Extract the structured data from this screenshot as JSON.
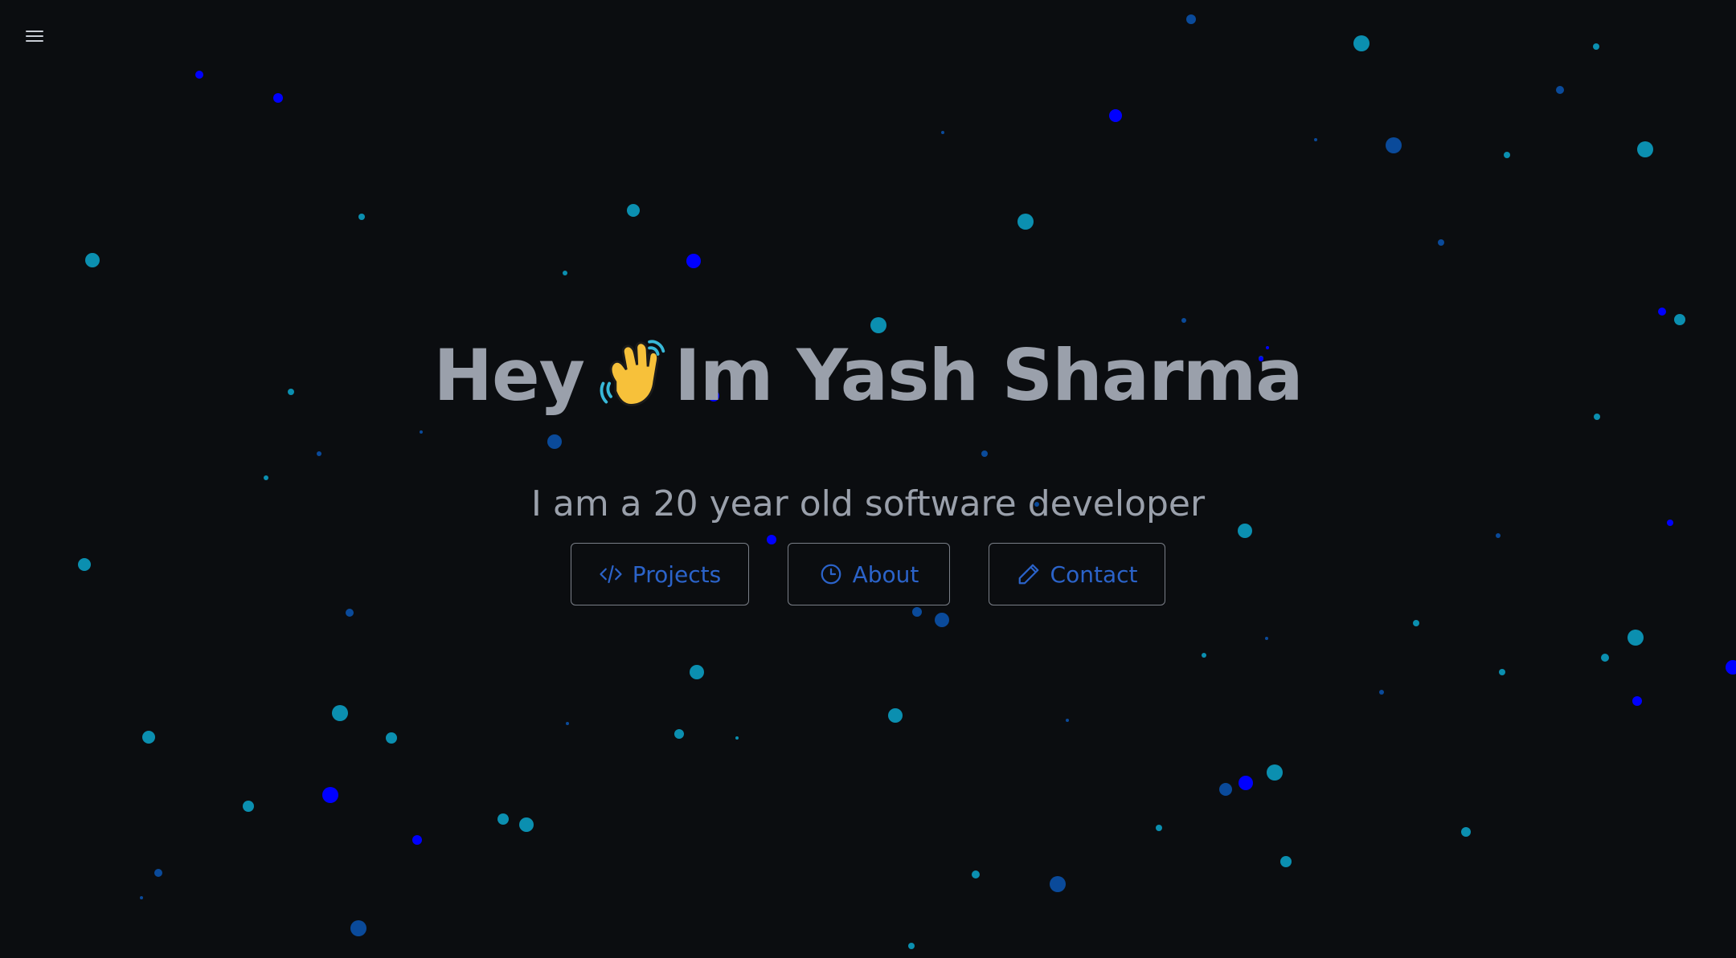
{
  "menu": {
    "icon": "hamburger-menu-icon"
  },
  "hero": {
    "greeting": "Hey",
    "wave_emoji": "waving-hand-emoji",
    "name_text": "Im Yash Sharma",
    "subtitle": "I am a 20 year old software developer"
  },
  "buttons": [
    {
      "label": "Projects",
      "icon": "code-icon"
    },
    {
      "label": "About",
      "icon": "clock-icon"
    },
    {
      "label": "Contact",
      "icon": "pencil-icon"
    }
  ],
  "colors": {
    "background": "#0b0d10",
    "text": "#9aa0ab",
    "accent": "#2b63c9",
    "particle_cyan": "#0b8fb0",
    "particle_blue": "#0000ff",
    "particle_navy": "#0a4a9a"
  }
}
